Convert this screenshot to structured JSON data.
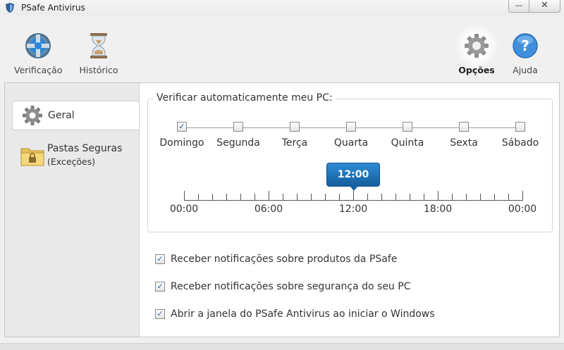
{
  "window": {
    "title": "PSafe Antivirus",
    "minimize_glyph": "—",
    "close_glyph": "✕"
  },
  "toolbar": {
    "items": [
      {
        "label": "Verificação",
        "icon": "scan-icon"
      },
      {
        "label": "Histórico",
        "icon": "hourglass-icon"
      },
      {
        "label": "Opções",
        "icon": "gear-icon",
        "active": true
      },
      {
        "label": "Ajuda",
        "icon": "help-icon"
      }
    ]
  },
  "sidebar": {
    "items": [
      {
        "label": "Geral",
        "icon": "gear-icon",
        "active": true
      },
      {
        "label": "Pastas Seguras",
        "sub": "(Exceções)",
        "icon": "locked-folder-icon"
      }
    ]
  },
  "schedule": {
    "title": "Verificar automaticamente meu PC:",
    "days": [
      {
        "label": "Domingo",
        "checked": true
      },
      {
        "label": "Segunda",
        "checked": false
      },
      {
        "label": "Terça",
        "checked": false
      },
      {
        "label": "Quarta",
        "checked": false
      },
      {
        "label": "Quinta",
        "checked": false
      },
      {
        "label": "Sexta",
        "checked": false
      },
      {
        "label": "Sábado",
        "checked": false
      }
    ],
    "selected_time": "12:00",
    "selected_fraction": 0.5,
    "hour_labels": [
      "00:00",
      "06:00",
      "12:00",
      "18:00",
      "00:00"
    ]
  },
  "options": [
    {
      "label": "Receber notificações sobre produtos da PSafe",
      "checked": true
    },
    {
      "label": "Receber notificações sobre segurança do seu PC",
      "checked": true
    },
    {
      "label": "Abrir a janela do PSafe Antivirus ao iniciar o Windows",
      "checked": true
    }
  ],
  "check_glyph": "✓",
  "colors": {
    "accent": "#1f73b8",
    "checkmark": "#2a5fa8"
  }
}
